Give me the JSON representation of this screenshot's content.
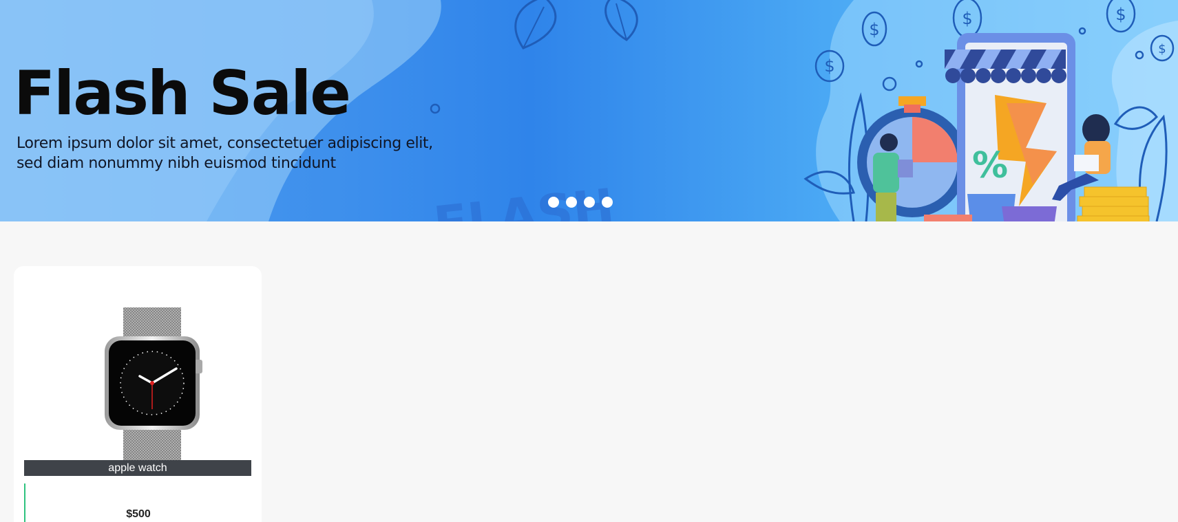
{
  "banner": {
    "title": "Flash Sale",
    "subtitle": "Lorem ipsum dolor sit amet, consectetuer adipiscing elit, sed diam nonummy nibh euismod tincidunt",
    "background_text": "FLASH",
    "illustration_sign": "%",
    "coin_symbol": "$",
    "slide_count": 4,
    "active_slide": 1
  },
  "products": [
    {
      "name": "apple watch",
      "price": "$500",
      "image": "apple-watch"
    }
  ],
  "colors": {
    "banner_blue": "#3d8fec",
    "page_background": "#f7f7f7",
    "name_bar": "#3f4349",
    "accent_green": "#2ec27e"
  }
}
